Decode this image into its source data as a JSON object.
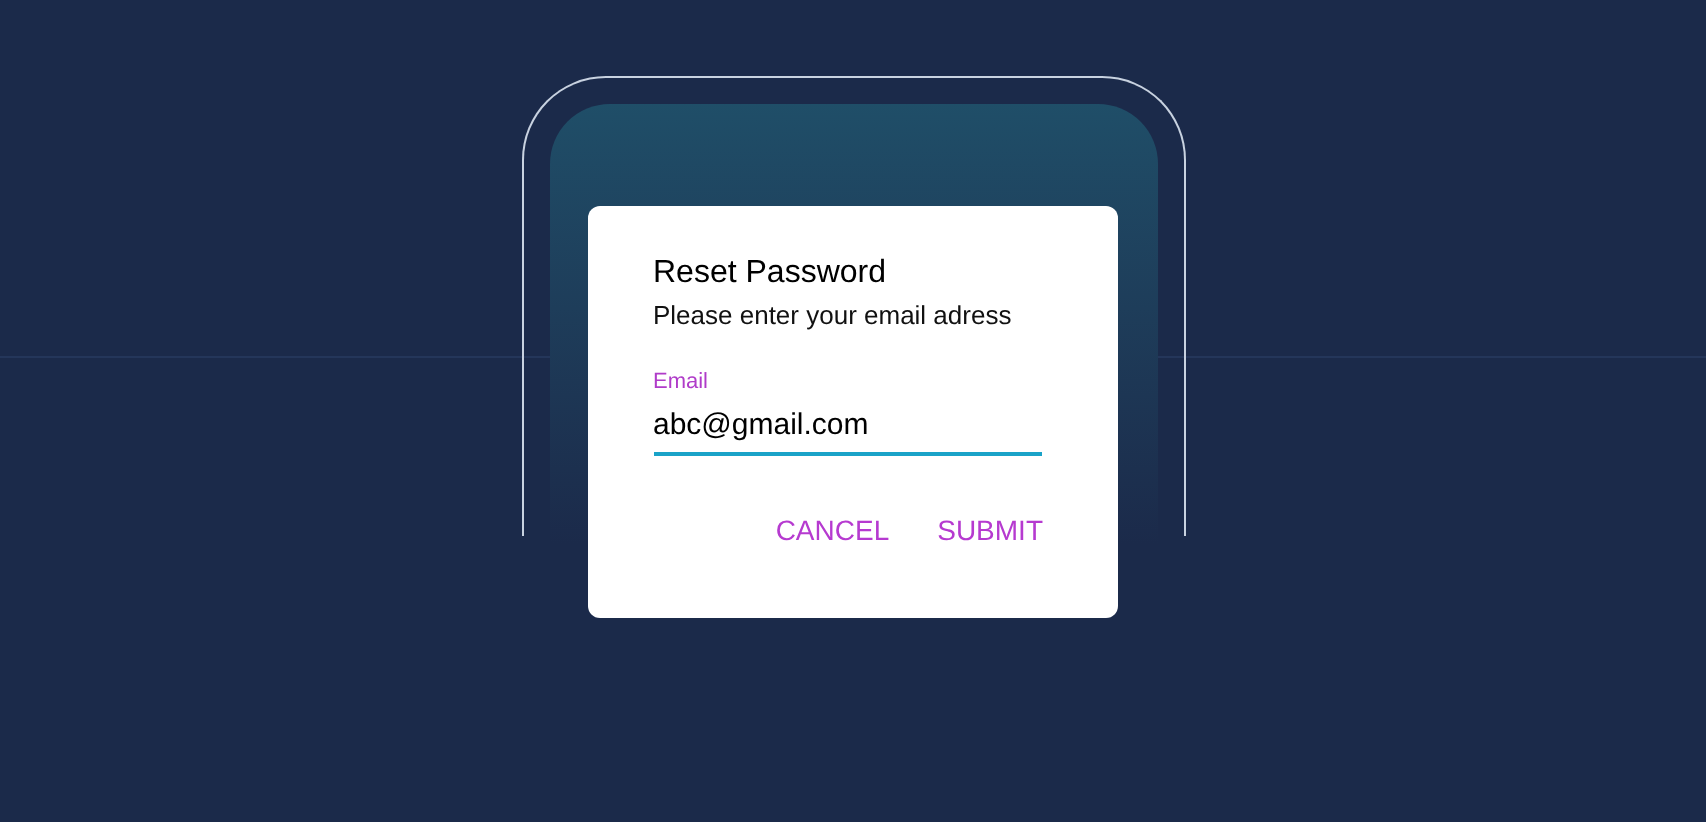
{
  "dialog": {
    "title": "Reset Password",
    "subtitle": "Please enter your email adress",
    "field": {
      "label": "Email",
      "value": "abc@gmail.com",
      "focused": true
    },
    "buttons": [
      "CANCEL",
      "SUBMIT"
    ]
  }
}
